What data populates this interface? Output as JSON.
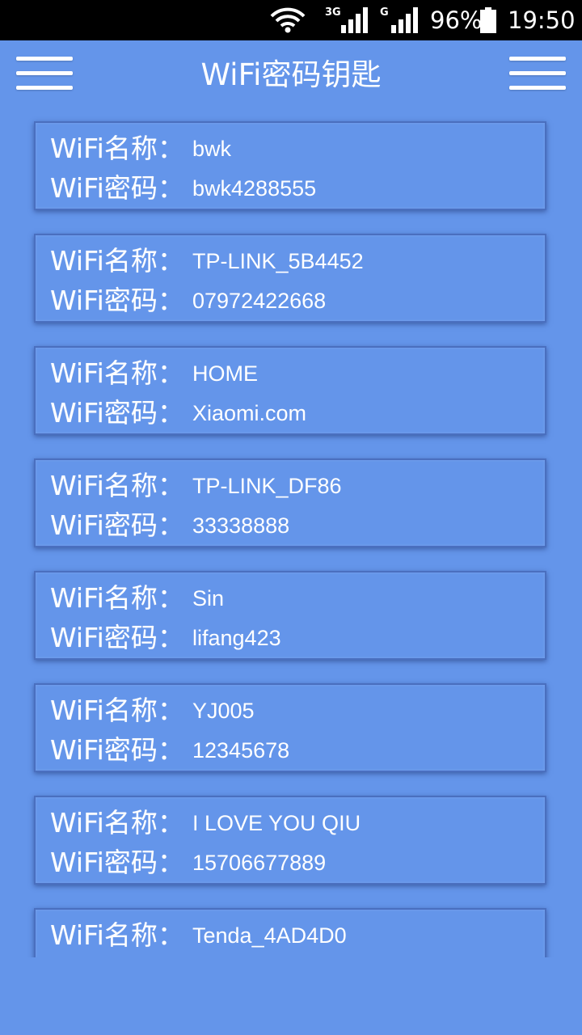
{
  "status_bar": {
    "network_3g_label": "3G",
    "network_g_label": "G",
    "battery_text": "96%",
    "time": "19:50",
    "icons": [
      "wifi-icon",
      "signal-icon",
      "signal-icon",
      "battery-icon"
    ]
  },
  "app_bar": {
    "title": "WiFi密码钥匙",
    "left_icon": "menu-icon",
    "right_icon": "menu-icon"
  },
  "colors": {
    "background": "#6495ea",
    "status_bar": "#000000",
    "text": "#ffffff"
  },
  "wifi_list": [
    {
      "name_label": "WiFi名称：",
      "name": "bwk",
      "password_label": "WiFi密码：",
      "password": "bwk4288555"
    },
    {
      "name_label": "WiFi名称：",
      "name": "TP-LINK_5B4452",
      "password_label": "WiFi密码：",
      "password": "07972422668"
    },
    {
      "name_label": "WiFi名称：",
      "name": "HOME",
      "password_label": "WiFi密码：",
      "password": "Xiaomi.com"
    },
    {
      "name_label": "WiFi名称：",
      "name": "TP-LINK_DF86",
      "password_label": "WiFi密码：",
      "password": "33338888"
    },
    {
      "name_label": "WiFi名称：",
      "name": "Sin",
      "password_label": "WiFi密码：",
      "password": "lifang423"
    },
    {
      "name_label": "WiFi名称：",
      "name": "YJ005",
      "password_label": "WiFi密码：",
      "password": "12345678"
    },
    {
      "name_label": "WiFi名称：",
      "name": "I LOVE YOU QIU",
      "password_label": "WiFi密码：",
      "password": "15706677889"
    },
    {
      "name_label": "WiFi名称：",
      "name": "Tenda_4AD4D0"
    }
  ]
}
